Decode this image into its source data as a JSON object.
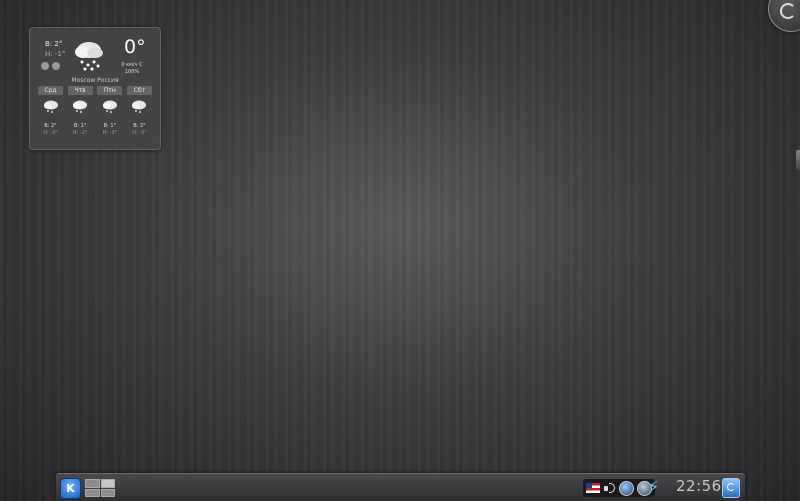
{
  "weather": {
    "high": "В: 2°",
    "low": "Н: -1°",
    "temperature": "0°",
    "wind": "0 км/ч С",
    "humidity": "100%",
    "location": "Moscow Россия",
    "condition_icon": "snow-cloud-icon",
    "days": [
      {
        "name": "Срд",
        "high": "В: 2°",
        "low": "Н: -2°",
        "icon": "snow-cloud-icon"
      },
      {
        "name": "Чтв",
        "high": "В: 1°",
        "low": "Н: -2°",
        "icon": "snow-cloud-icon"
      },
      {
        "name": "Птн",
        "high": "В: 1°",
        "low": "Н: -3°",
        "icon": "snow-cloud-icon"
      },
      {
        "name": "Сбт",
        "high": "В: 2°",
        "low": "Н: -3°",
        "icon": "snow-cloud-icon"
      }
    ]
  },
  "panel": {
    "kmenu_label": "K",
    "clock": "22:56",
    "tray_icons": [
      "us-flag-icon",
      "speaker-icon",
      "globe-icon",
      "network-icon"
    ],
    "pager_active_desktop": 2
  },
  "colors": {
    "accent": "#2f6bb5",
    "panel_bg": "#3a3a3c",
    "desktop_bg": "#3e3e40"
  }
}
